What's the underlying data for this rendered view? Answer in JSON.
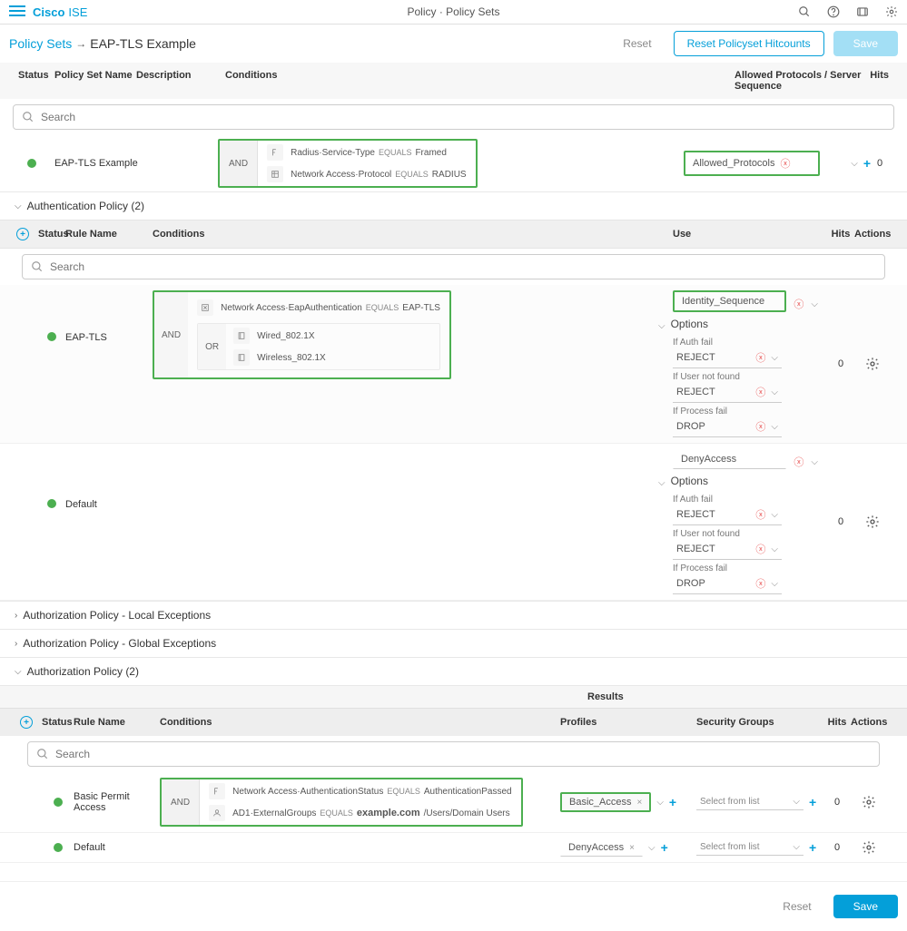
{
  "header": {
    "logo_cisco": "Cisco",
    "logo_ise": "ISE",
    "page_title": "Policy · Policy Sets"
  },
  "breadcrumb": {
    "link": "Policy Sets",
    "current": "EAP-TLS Example",
    "reset": "Reset",
    "reset_hitcounts": "Reset Policyset Hitcounts",
    "save": "Save"
  },
  "policy_header": {
    "status": "Status",
    "name": "Policy Set Name",
    "description": "Description",
    "conditions": "Conditions",
    "allowed": "Allowed Protocols / Server Sequence",
    "hits": "Hits"
  },
  "search_placeholder": "Search",
  "policy_row": {
    "name": "EAP-TLS Example",
    "op": "AND",
    "cond1_attr": "Radius·Service-Type",
    "cond1_val": "Framed",
    "cond2_attr": "Network Access·Protocol",
    "cond2_val": "RADIUS",
    "equals": "EQUALS",
    "allowed": "Allowed_Protocols",
    "hits": "0"
  },
  "sections": {
    "auth_policy": "Authentication Policy (2)",
    "authz_local": "Authorization Policy - Local Exceptions",
    "authz_global": "Authorization Policy - Global Exceptions",
    "authz_policy": "Authorization Policy (2)"
  },
  "auth_header": {
    "status": "Status",
    "rule": "Rule Name",
    "conditions": "Conditions",
    "use": "Use",
    "hits": "Hits",
    "actions": "Actions"
  },
  "eap_row": {
    "name": "EAP-TLS",
    "op_and": "AND",
    "op_or": "OR",
    "cond1_attr": "Network Access·EapAuthentication",
    "cond1_val": "EAP-TLS",
    "equals": "EQUALS",
    "wired": "Wired_802.1X",
    "wireless": "Wireless_802.1X",
    "identity": "Identity_Sequence",
    "options": "Options",
    "auth_fail_label": "If Auth fail",
    "auth_fail_val": "REJECT",
    "user_nf_label": "If User not found",
    "user_nf_val": "REJECT",
    "process_fail_label": "If Process fail",
    "process_fail_val": "DROP",
    "hits": "0"
  },
  "default_row": {
    "name": "Default",
    "use_val": "DenyAccess",
    "options": "Options",
    "auth_fail_label": "If Auth fail",
    "auth_fail_val": "REJECT",
    "user_nf_label": "If User not found",
    "user_nf_val": "REJECT",
    "process_fail_label": "If Process fail",
    "process_fail_val": "DROP",
    "hits": "0"
  },
  "authz_header": {
    "status": "Status",
    "rule": "Rule Name",
    "conditions": "Conditions",
    "results": "Results",
    "profiles": "Profiles",
    "security_groups": "Security Groups",
    "hits": "Hits",
    "actions": "Actions"
  },
  "authz_row1": {
    "name": "Basic Permit Access",
    "op": "AND",
    "c1_attr": "Network Access·AuthenticationStatus",
    "c1_val": "AuthenticationPassed",
    "c2_attr": "AD1·ExternalGroups",
    "c2_dom": "example.com",
    "c2_rest": "/Users/Domain Users",
    "equals": "EQUALS",
    "profile": "Basic_Access",
    "select_list": "Select from list",
    "hits": "0"
  },
  "authz_row2": {
    "name": "Default",
    "profile": "DenyAccess",
    "select_list": "Select from list",
    "hits": "0"
  },
  "footer": {
    "reset": "Reset",
    "save": "Save"
  }
}
